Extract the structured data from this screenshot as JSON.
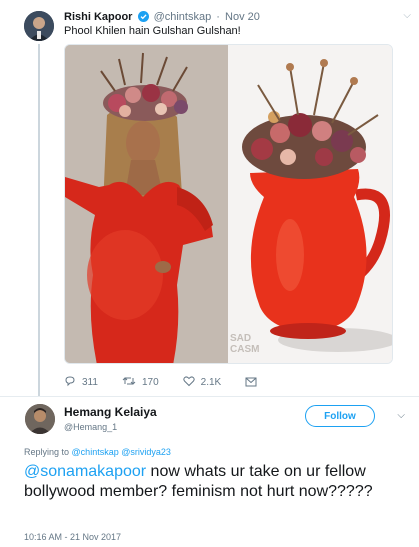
{
  "tweet1": {
    "name": "Rishi Kapoor",
    "handle": "@chintskap",
    "separator": "·",
    "date": "Nov 20",
    "text": "Phool Khilen hain Gulshan Gulshan!",
    "watermark": "SAD CASM",
    "replies": "311",
    "retweets": "170",
    "likes": "2.1K"
  },
  "tweet2": {
    "name": "Hemang Kelaiya",
    "handle": "@Hemang_1",
    "follow_label": "Follow",
    "replying_prefix": "Replying to",
    "replying_to_1": "@chintskap",
    "replying_to_2": "@srividya23",
    "mention": "@sonamakapoor",
    "text_rest": " now whats ur take on ur fellow bollywood member? feminism not hurt now?????",
    "timestamp": "10:16 AM - 21 Nov 2017"
  },
  "colors": {
    "accent": "#1da1f2",
    "muted": "#657786",
    "dress_red": "#d6281b",
    "jug_red": "#e8321c"
  },
  "icons": {
    "reply": "reply-icon",
    "retweet": "retweet-icon",
    "like": "heart-icon",
    "message": "envelope-icon",
    "verified": "verified-badge-icon",
    "menu": "chevron-down-icon"
  }
}
